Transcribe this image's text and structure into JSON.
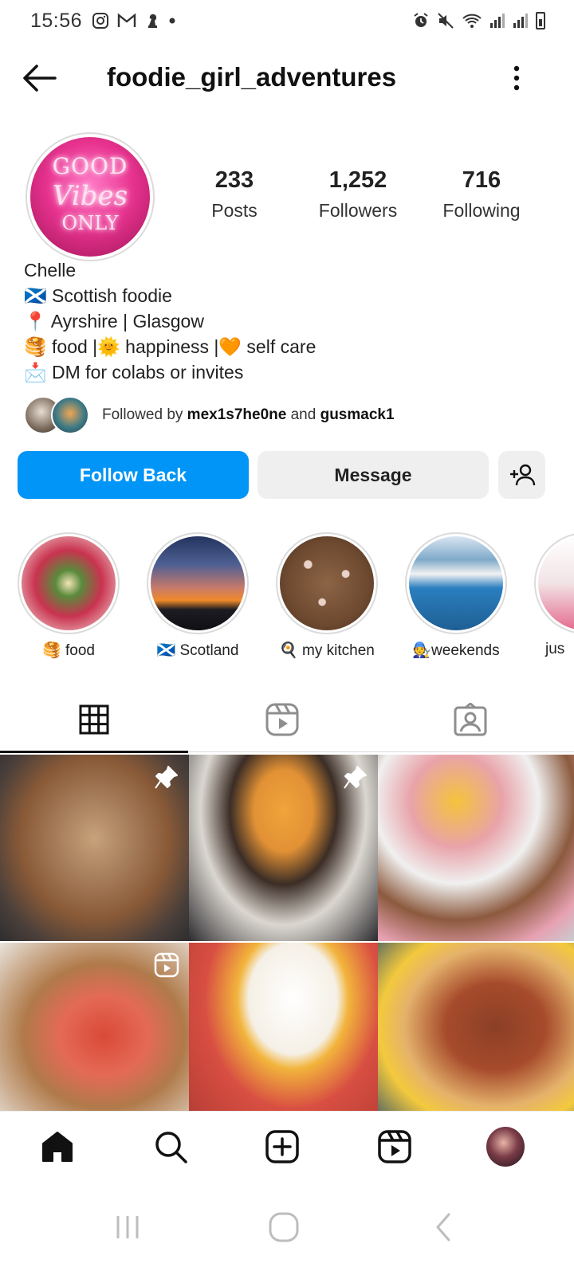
{
  "status_bar": {
    "time": "15:56",
    "left_icons": [
      "instagram-icon",
      "gmail-icon",
      "chess-icon",
      "dot-icon"
    ],
    "right_icons": [
      "alarm-icon",
      "mute-icon",
      "wifi-icon",
      "signal-icon",
      "signal-icon",
      "battery-icon"
    ]
  },
  "header": {
    "username": "foodie_girl_adventures"
  },
  "profile": {
    "avatar_text": [
      "GOOD",
      "Vibes",
      "ONLY"
    ],
    "stats": [
      {
        "value": "233",
        "label": "Posts"
      },
      {
        "value": "1,252",
        "label": "Followers"
      },
      {
        "value": "716",
        "label": "Following"
      }
    ],
    "name": "Chelle",
    "bio": [
      "🏴󠁧󠁢󠁳󠁣󠁴󠁿 Scottish foodie",
      "📍 Ayrshire | Glasgow",
      "🥞 food |🌞 happiness |🧡 self care",
      "📩 DM for colabs or invites"
    ],
    "followed_by_prefix": "Followed by ",
    "followed_by_user1": "mex1s7he0ne",
    "followed_by_and": " and ",
    "followed_by_user2": "gusmack1"
  },
  "actions": {
    "follow_back": "Follow Back",
    "message": "Message"
  },
  "highlights": [
    {
      "label": "🥞 food",
      "color": "#c9334f"
    },
    {
      "label": "🏴󠁧󠁢󠁳󠁣󠁴󠁿 Scotland",
      "color": "#24345f"
    },
    {
      "label": "🍳 my kitchen",
      "color": "#7a5136"
    },
    {
      "label": "🧑‍🔧weekends",
      "color": "#2a7fbf"
    },
    {
      "label": "jus",
      "color": "#f1e3e6"
    }
  ],
  "tabs": [
    "grid-icon",
    "reels-icon",
    "tagged-icon"
  ],
  "grid_posts": [
    {
      "badge": "pin-icon"
    },
    {
      "badge": "pin-icon"
    },
    {
      "badge": ""
    },
    {
      "badge": "reel-icon"
    },
    {
      "badge": ""
    },
    {
      "badge": ""
    }
  ],
  "bottom_nav": [
    "home-icon",
    "search-icon",
    "create-icon",
    "reels-icon",
    "profile-avatar"
  ],
  "colors": {
    "accent": "#0095f6",
    "button_secondary": "#efefef",
    "text": "#111111"
  }
}
